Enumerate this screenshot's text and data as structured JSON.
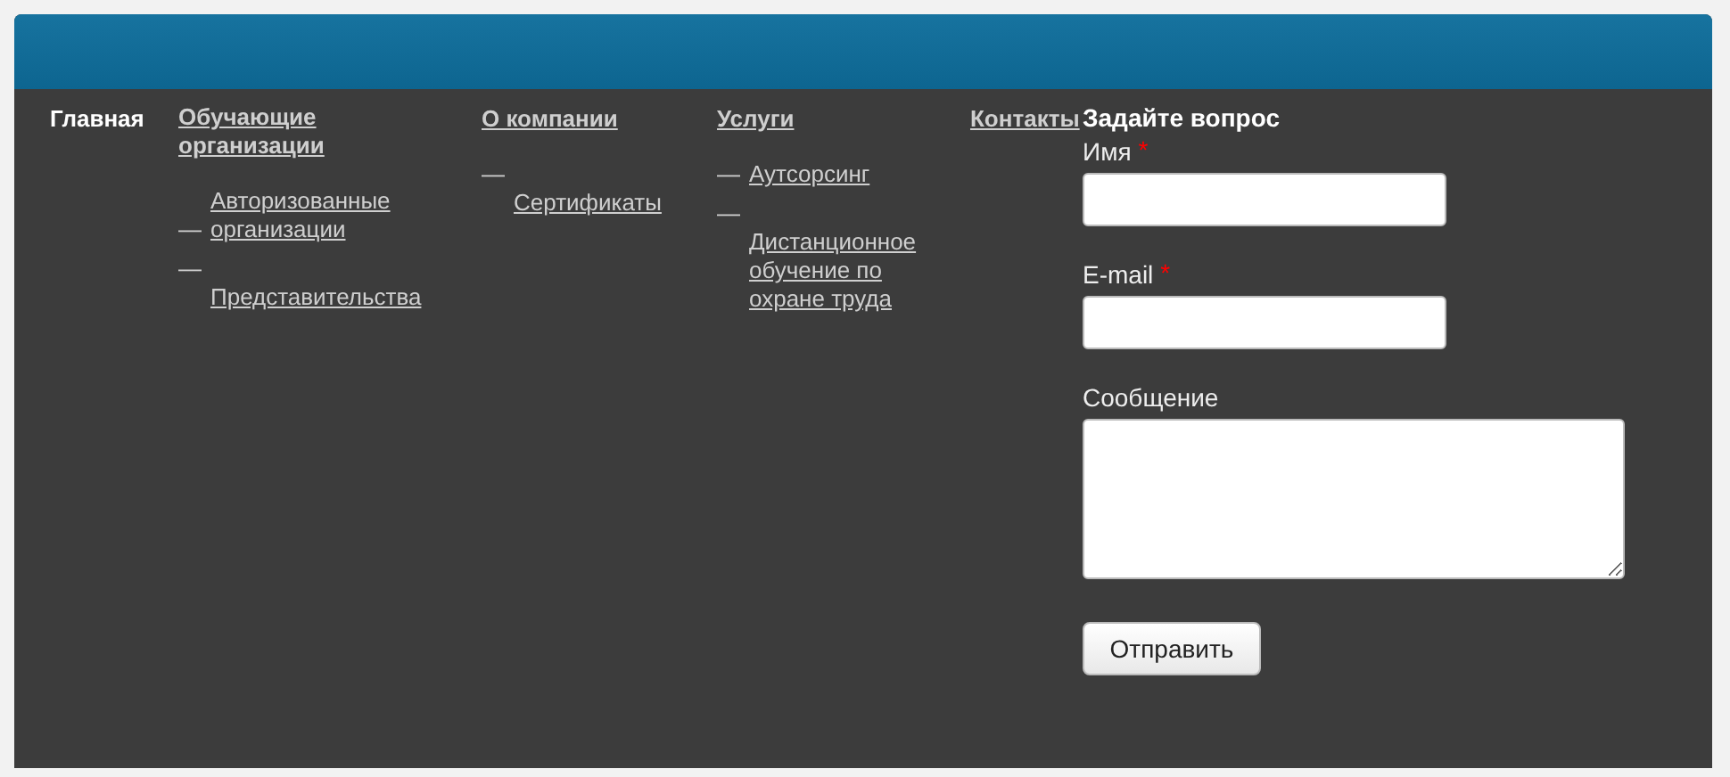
{
  "nav": [
    {
      "label": "Главная",
      "selected": true
    },
    {
      "label": "Обучающие организации",
      "selected": false,
      "children": [
        {
          "label": "Авторизованные организации"
        },
        {
          "label": "Представительства"
        }
      ]
    },
    {
      "label": "О компании",
      "selected": false,
      "children": [
        {
          "label": "Сертификаты"
        }
      ]
    },
    {
      "label": "Услуги",
      "selected": false,
      "children": [
        {
          "label": "Аутсорсинг"
        },
        {
          "label": "Дистанционное обучение по охране труда"
        }
      ]
    },
    {
      "label": "Контакты",
      "selected": false
    }
  ],
  "sub_marker": "—",
  "form": {
    "title": "Задайте вопрос",
    "required_mark": "*",
    "fields": [
      {
        "kind": "input",
        "label": "Имя",
        "required": true
      },
      {
        "kind": "input",
        "label": "E-mail",
        "required": true
      },
      {
        "kind": "textarea",
        "label": "Сообщение",
        "required": false
      }
    ],
    "submit": "Отправить"
  }
}
